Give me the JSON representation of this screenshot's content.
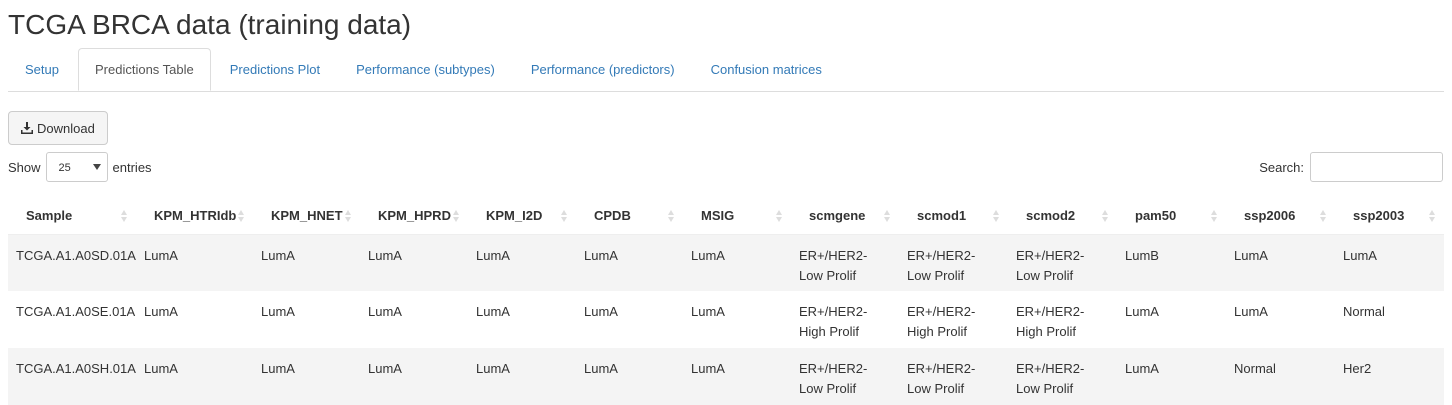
{
  "page": {
    "title": "TCGA BRCA data (training data)"
  },
  "tabs": [
    {
      "label": "Setup",
      "active": false
    },
    {
      "label": "Predictions Table",
      "active": true
    },
    {
      "label": "Predictions Plot",
      "active": false
    },
    {
      "label": "Performance (subtypes)",
      "active": false
    },
    {
      "label": "Performance (predictors)",
      "active": false
    },
    {
      "label": "Confusion matrices",
      "active": false
    }
  ],
  "toolbar": {
    "download_label": "Download",
    "download_icon": "download-icon"
  },
  "length_control": {
    "show_label": "Show",
    "selected": "25",
    "entries_label": "entries"
  },
  "search": {
    "label": "Search:",
    "value": ""
  },
  "table": {
    "columns": [
      "Sample",
      "KPM_HTRIdb",
      "KPM_HNET",
      "KPM_HPRD",
      "KPM_I2D",
      "CPDB",
      "MSIG",
      "scmgene",
      "scmod1",
      "scmod2",
      "pam50",
      "ssp2006",
      "ssp2003"
    ],
    "rows": [
      [
        "TCGA.A1.A0SD.01A",
        "LumA",
        "LumA",
        "LumA",
        "LumA",
        "LumA",
        "LumA",
        "ER+/HER2- Low Prolif",
        "ER+/HER2- Low Prolif",
        "ER+/HER2- Low Prolif",
        "LumB",
        "LumA",
        "LumA"
      ],
      [
        "TCGA.A1.A0SE.01A",
        "LumA",
        "LumA",
        "LumA",
        "LumA",
        "LumA",
        "LumA",
        "ER+/HER2- High Prolif",
        "ER+/HER2- High Prolif",
        "ER+/HER2- High Prolif",
        "LumA",
        "LumA",
        "Normal"
      ],
      [
        "TCGA.A1.A0SH.01A",
        "LumA",
        "LumA",
        "LumA",
        "LumA",
        "LumA",
        "LumA",
        "ER+/HER2- Low Prolif",
        "ER+/HER2- Low Prolif",
        "ER+/HER2- Low Prolif",
        "LumA",
        "Normal",
        "Her2"
      ]
    ]
  }
}
